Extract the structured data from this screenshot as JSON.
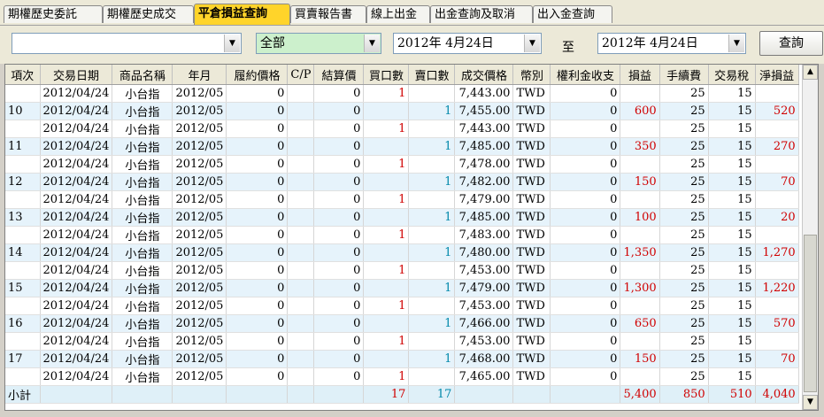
{
  "tabs": [
    {
      "label": "期權歷史委託",
      "active": false
    },
    {
      "label": "期權歷史成交",
      "active": false
    },
    {
      "label": "平倉損益查詢",
      "active": true
    },
    {
      "label": "買賣報告書",
      "active": false
    },
    {
      "label": "線上出金",
      "active": false
    },
    {
      "label": "出金查詢及取消",
      "active": false
    },
    {
      "label": "出入金查詢",
      "active": false
    }
  ],
  "filters": {
    "account_value": "",
    "product_value": "全部",
    "date_from": "2012年  4月24日",
    "to_label": "至",
    "date_to": "2012年  4月24日",
    "query_button": "查詢"
  },
  "table": {
    "columns": [
      "項次",
      "交易日期",
      "商品名稱",
      "年月",
      "履約價格",
      "C/P",
      "結算價",
      "買口數",
      "賣口數",
      "成交價格",
      "幣別",
      "權利金收支",
      "損益",
      "手續費",
      "交易稅",
      "淨損益"
    ],
    "rows": [
      {
        "no": "",
        "date": "2012/04/24",
        "product": "小台指",
        "ym": "2012/05",
        "strike": "0",
        "cp": "",
        "settle": "0",
        "buy": "1",
        "sell": "",
        "price": "7,443.00",
        "cur": "TWD",
        "premium": "0",
        "pl": "",
        "fee": "25",
        "tax": "15",
        "net": ""
      },
      {
        "no": "10",
        "date": "2012/04/24",
        "product": "小台指",
        "ym": "2012/05",
        "strike": "0",
        "cp": "",
        "settle": "0",
        "buy": "",
        "sell": "1",
        "price": "7,455.00",
        "cur": "TWD",
        "premium": "0",
        "pl": "600",
        "fee": "25",
        "tax": "15",
        "net": "520"
      },
      {
        "no": "",
        "date": "2012/04/24",
        "product": "小台指",
        "ym": "2012/05",
        "strike": "0",
        "cp": "",
        "settle": "0",
        "buy": "1",
        "sell": "",
        "price": "7,443.00",
        "cur": "TWD",
        "premium": "0",
        "pl": "",
        "fee": "25",
        "tax": "15",
        "net": ""
      },
      {
        "no": "11",
        "date": "2012/04/24",
        "product": "小台指",
        "ym": "2012/05",
        "strike": "0",
        "cp": "",
        "settle": "0",
        "buy": "",
        "sell": "1",
        "price": "7,485.00",
        "cur": "TWD",
        "premium": "0",
        "pl": "350",
        "fee": "25",
        "tax": "15",
        "net": "270"
      },
      {
        "no": "",
        "date": "2012/04/24",
        "product": "小台指",
        "ym": "2012/05",
        "strike": "0",
        "cp": "",
        "settle": "0",
        "buy": "1",
        "sell": "",
        "price": "7,478.00",
        "cur": "TWD",
        "premium": "0",
        "pl": "",
        "fee": "25",
        "tax": "15",
        "net": ""
      },
      {
        "no": "12",
        "date": "2012/04/24",
        "product": "小台指",
        "ym": "2012/05",
        "strike": "0",
        "cp": "",
        "settle": "0",
        "buy": "",
        "sell": "1",
        "price": "7,482.00",
        "cur": "TWD",
        "premium": "0",
        "pl": "150",
        "fee": "25",
        "tax": "15",
        "net": "70"
      },
      {
        "no": "",
        "date": "2012/04/24",
        "product": "小台指",
        "ym": "2012/05",
        "strike": "0",
        "cp": "",
        "settle": "0",
        "buy": "1",
        "sell": "",
        "price": "7,479.00",
        "cur": "TWD",
        "premium": "0",
        "pl": "",
        "fee": "25",
        "tax": "15",
        "net": ""
      },
      {
        "no": "13",
        "date": "2012/04/24",
        "product": "小台指",
        "ym": "2012/05",
        "strike": "0",
        "cp": "",
        "settle": "0",
        "buy": "",
        "sell": "1",
        "price": "7,485.00",
        "cur": "TWD",
        "premium": "0",
        "pl": "100",
        "fee": "25",
        "tax": "15",
        "net": "20"
      },
      {
        "no": "",
        "date": "2012/04/24",
        "product": "小台指",
        "ym": "2012/05",
        "strike": "0",
        "cp": "",
        "settle": "0",
        "buy": "1",
        "sell": "",
        "price": "7,483.00",
        "cur": "TWD",
        "premium": "0",
        "pl": "",
        "fee": "25",
        "tax": "15",
        "net": ""
      },
      {
        "no": "14",
        "date": "2012/04/24",
        "product": "小台指",
        "ym": "2012/05",
        "strike": "0",
        "cp": "",
        "settle": "0",
        "buy": "",
        "sell": "1",
        "price": "7,480.00",
        "cur": "TWD",
        "premium": "0",
        "pl": "1,350",
        "fee": "25",
        "tax": "15",
        "net": "1,270"
      },
      {
        "no": "",
        "date": "2012/04/24",
        "product": "小台指",
        "ym": "2012/05",
        "strike": "0",
        "cp": "",
        "settle": "0",
        "buy": "1",
        "sell": "",
        "price": "7,453.00",
        "cur": "TWD",
        "premium": "0",
        "pl": "",
        "fee": "25",
        "tax": "15",
        "net": ""
      },
      {
        "no": "15",
        "date": "2012/04/24",
        "product": "小台指",
        "ym": "2012/05",
        "strike": "0",
        "cp": "",
        "settle": "0",
        "buy": "",
        "sell": "1",
        "price": "7,479.00",
        "cur": "TWD",
        "premium": "0",
        "pl": "1,300",
        "fee": "25",
        "tax": "15",
        "net": "1,220"
      },
      {
        "no": "",
        "date": "2012/04/24",
        "product": "小台指",
        "ym": "2012/05",
        "strike": "0",
        "cp": "",
        "settle": "0",
        "buy": "1",
        "sell": "",
        "price": "7,453.00",
        "cur": "TWD",
        "premium": "0",
        "pl": "",
        "fee": "25",
        "tax": "15",
        "net": ""
      },
      {
        "no": "16",
        "date": "2012/04/24",
        "product": "小台指",
        "ym": "2012/05",
        "strike": "0",
        "cp": "",
        "settle": "0",
        "buy": "",
        "sell": "1",
        "price": "7,466.00",
        "cur": "TWD",
        "premium": "0",
        "pl": "650",
        "fee": "25",
        "tax": "15",
        "net": "570"
      },
      {
        "no": "",
        "date": "2012/04/24",
        "product": "小台指",
        "ym": "2012/05",
        "strike": "0",
        "cp": "",
        "settle": "0",
        "buy": "1",
        "sell": "",
        "price": "7,453.00",
        "cur": "TWD",
        "premium": "0",
        "pl": "",
        "fee": "25",
        "tax": "15",
        "net": ""
      },
      {
        "no": "17",
        "date": "2012/04/24",
        "product": "小台指",
        "ym": "2012/05",
        "strike": "0",
        "cp": "",
        "settle": "0",
        "buy": "",
        "sell": "1",
        "price": "7,468.00",
        "cur": "TWD",
        "premium": "0",
        "pl": "150",
        "fee": "25",
        "tax": "15",
        "net": "70"
      },
      {
        "no": "",
        "date": "2012/04/24",
        "product": "小台指",
        "ym": "2012/05",
        "strike": "0",
        "cp": "",
        "settle": "0",
        "buy": "1",
        "sell": "",
        "price": "7,465.00",
        "cur": "TWD",
        "premium": "0",
        "pl": "",
        "fee": "25",
        "tax": "15",
        "net": ""
      }
    ],
    "total": {
      "label": "小計",
      "buy": "17",
      "sell": "17",
      "pl": "5,400",
      "fee": "850",
      "tax": "510",
      "net": "4,040"
    }
  },
  "colors": {
    "active_tab": "#ffd42a",
    "alt_row": "#e6f3fb",
    "profit_red": "#d00000",
    "sell_blue": "#0088aa",
    "green_combo": "#ccf0cc"
  }
}
